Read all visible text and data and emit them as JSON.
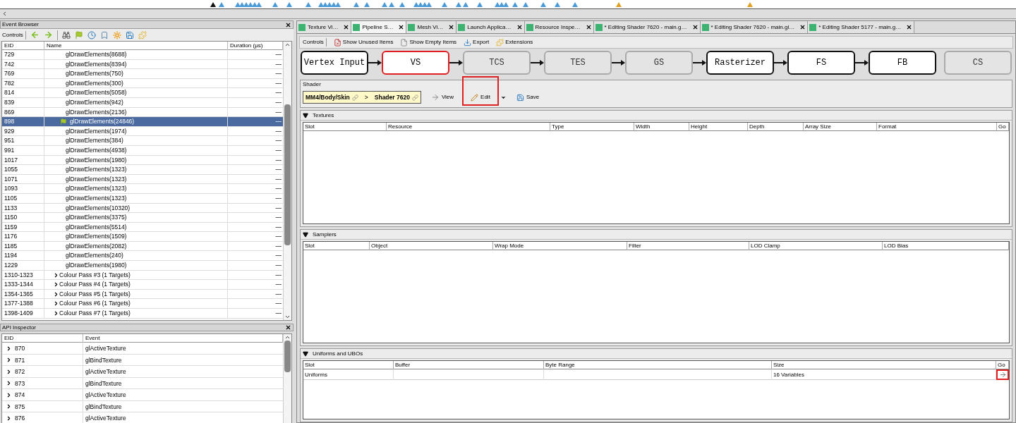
{
  "event_browser": {
    "title": "Event Browser",
    "controls_label": "Controls",
    "columns": [
      "EID",
      "Name",
      "Duration (µs)"
    ],
    "rows": [
      {
        "eid": "729",
        "name": "glDrawElements(8688)",
        "kind": "draw",
        "selected": false,
        "duration": "—"
      },
      {
        "eid": "742",
        "name": "glDrawElements(8394)",
        "kind": "draw",
        "selected": false,
        "duration": "—"
      },
      {
        "eid": "769",
        "name": "glDrawElements(750)",
        "kind": "draw",
        "selected": false,
        "duration": "—"
      },
      {
        "eid": "782",
        "name": "glDrawElements(300)",
        "kind": "draw",
        "selected": false,
        "duration": "—"
      },
      {
        "eid": "814",
        "name": "glDrawElements(5058)",
        "kind": "draw",
        "selected": false,
        "duration": "—"
      },
      {
        "eid": "839",
        "name": "glDrawElements(942)",
        "kind": "draw",
        "selected": false,
        "duration": "—"
      },
      {
        "eid": "869",
        "name": "glDrawElements(2136)",
        "kind": "draw",
        "selected": false,
        "duration": "—"
      },
      {
        "eid": "898",
        "name": "glDrawElements(24846)",
        "kind": "draw",
        "selected": true,
        "duration": "—"
      },
      {
        "eid": "929",
        "name": "glDrawElements(1974)",
        "kind": "draw",
        "selected": false,
        "duration": "—"
      },
      {
        "eid": "951",
        "name": "glDrawElements(384)",
        "kind": "draw",
        "selected": false,
        "duration": "—"
      },
      {
        "eid": "991",
        "name": "glDrawElements(4938)",
        "kind": "draw",
        "selected": false,
        "duration": "—"
      },
      {
        "eid": "1017",
        "name": "glDrawElements(1980)",
        "kind": "draw",
        "selected": false,
        "duration": "—"
      },
      {
        "eid": "1055",
        "name": "glDrawElements(1323)",
        "kind": "draw",
        "selected": false,
        "duration": "—"
      },
      {
        "eid": "1071",
        "name": "glDrawElements(1323)",
        "kind": "draw",
        "selected": false,
        "duration": "—"
      },
      {
        "eid": "1093",
        "name": "glDrawElements(1323)",
        "kind": "draw",
        "selected": false,
        "duration": "—"
      },
      {
        "eid": "1105",
        "name": "glDrawElements(1323)",
        "kind": "draw",
        "selected": false,
        "duration": "—"
      },
      {
        "eid": "1133",
        "name": "glDrawElements(10320)",
        "kind": "draw",
        "selected": false,
        "duration": "—"
      },
      {
        "eid": "1150",
        "name": "glDrawElements(3375)",
        "kind": "draw",
        "selected": false,
        "duration": "—"
      },
      {
        "eid": "1159",
        "name": "glDrawElements(5514)",
        "kind": "draw",
        "selected": false,
        "duration": "—"
      },
      {
        "eid": "1176",
        "name": "glDrawElements(1509)",
        "kind": "draw",
        "selected": false,
        "duration": "—"
      },
      {
        "eid": "1185",
        "name": "glDrawElements(2082)",
        "kind": "draw",
        "selected": false,
        "duration": "—"
      },
      {
        "eid": "1194",
        "name": "glDrawElements(240)",
        "kind": "draw",
        "selected": false,
        "duration": "—"
      },
      {
        "eid": "1229",
        "name": "glDrawElements(1980)",
        "kind": "draw",
        "selected": false,
        "duration": "—"
      },
      {
        "eid": "1310-1323",
        "name": "Colour Pass #3 (1 Targets)",
        "kind": "pass",
        "selected": false,
        "duration": "—"
      },
      {
        "eid": "1333-1344",
        "name": "Colour Pass #4 (1 Targets)",
        "kind": "pass",
        "selected": false,
        "duration": "—"
      },
      {
        "eid": "1354-1365",
        "name": "Colour Pass #5 (1 Targets)",
        "kind": "pass",
        "selected": false,
        "duration": "—"
      },
      {
        "eid": "1377-1388",
        "name": "Colour Pass #6 (1 Targets)",
        "kind": "pass",
        "selected": false,
        "duration": "—"
      },
      {
        "eid": "1398-1409",
        "name": "Colour Pass #7 (1 Targets)",
        "kind": "pass",
        "selected": false,
        "duration": "—"
      }
    ]
  },
  "api_inspector": {
    "title": "API Inspector",
    "columns": [
      "EID",
      "Event"
    ],
    "rows": [
      {
        "eid": "870",
        "event": "glActiveTexture"
      },
      {
        "eid": "871",
        "event": "glBindTexture"
      },
      {
        "eid": "872",
        "event": "glActiveTexture"
      },
      {
        "eid": "873",
        "event": "glBindTexture"
      },
      {
        "eid": "874",
        "event": "glActiveTexture"
      },
      {
        "eid": "875",
        "event": "glBindTexture"
      },
      {
        "eid": "876",
        "event": "glActiveTexture"
      }
    ]
  },
  "tabs": [
    {
      "label": "Texture Vi…",
      "selected": false
    },
    {
      "label": "Pipeline S…",
      "selected": true
    },
    {
      "label": "Mesh Vi…",
      "selected": false
    },
    {
      "label": "Launch Applica…",
      "selected": false
    },
    {
      "label": "Resource Inspe…",
      "selected": false
    },
    {
      "label": "* Editing Shader 7620 - main.g…",
      "selected": false
    },
    {
      "label": "* Editing Shader 7620 - main.gl…",
      "selected": false
    },
    {
      "label": "* Editing Shader 5177 - main.g…",
      "selected": false
    }
  ],
  "toolbar": {
    "label": "Controls",
    "buttons": [
      "Show Unused Items",
      "Show Empty Items",
      "Export",
      "Extensions"
    ]
  },
  "pipeline": [
    {
      "label": "Vertex Input",
      "enabled": true,
      "selected": false
    },
    {
      "label": "VS",
      "enabled": true,
      "selected": true
    },
    {
      "label": "TCS",
      "enabled": false,
      "selected": false
    },
    {
      "label": "TES",
      "enabled": false,
      "selected": false
    },
    {
      "label": "GS",
      "enabled": false,
      "selected": false
    },
    {
      "label": "Rasterizer",
      "enabled": true,
      "selected": false
    },
    {
      "label": "FS",
      "enabled": true,
      "selected": false
    },
    {
      "label": "FB",
      "enabled": true,
      "selected": false
    }
  ],
  "compute_stage": {
    "label": "CS",
    "enabled": false,
    "selected": false
  },
  "shader": {
    "label": "Shader",
    "path": "MM4/Body/Skin",
    "separator": ">",
    "name": "Shader 7620",
    "buttons": [
      {
        "label": "View",
        "highlighted": false
      },
      {
        "label": "Edit",
        "highlighted": true
      },
      {
        "label": "Save",
        "highlighted": false
      }
    ]
  },
  "sections": [
    {
      "title": "Textures",
      "expanded": true,
      "columns": [
        "Slot",
        "Resource",
        "Type",
        "Width",
        "Height",
        "Depth",
        "Array Size",
        "Format",
        "Go"
      ]
    },
    {
      "title": "Samplers",
      "expanded": true,
      "columns": [
        "Slot",
        "Object",
        "Wrap Mode",
        "Filter",
        "LOD Clamp",
        "LOD Bias"
      ]
    },
    {
      "title": "Uniforms and UBOs",
      "expanded": true,
      "columns": [
        "Slot",
        "Buffer",
        "Byte Range",
        "Size",
        "Go"
      ],
      "rows": [
        {
          "cells": [
            "Uniforms",
            "",
            "",
            "16 Variables"
          ],
          "go_highlighted": true
        }
      ]
    }
  ]
}
